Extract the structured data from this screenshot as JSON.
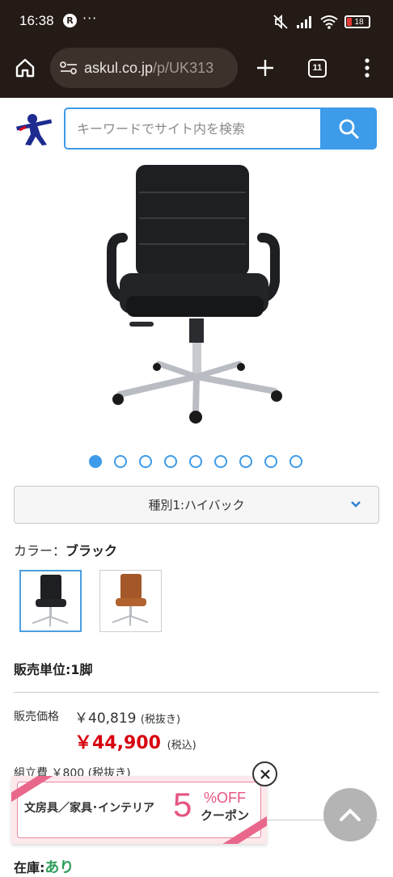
{
  "status_bar": {
    "time": "16:38",
    "notif_badge": "R",
    "more": "···",
    "battery": "18"
  },
  "browser": {
    "url_host": "askul.co.jp",
    "url_path": "/p/UK313",
    "tab_count": "11"
  },
  "header": {
    "search_placeholder": "キーワードでサイト内を検索"
  },
  "gallery": {
    "dot_count": 9,
    "active_index": 0
  },
  "variant": {
    "label": "種別1:ハイバック"
  },
  "color": {
    "label": "カラー：",
    "value": "ブラック",
    "options": [
      "ブラック",
      "ブラウン"
    ]
  },
  "unit": "販売単位:1脚",
  "price": {
    "label": "販売価格",
    "ex_tax": "￥40,819",
    "ex_tax_note": "(税抜き)",
    "in_tax": "￥44,900",
    "in_tax_note": "(税込)"
  },
  "assembly_partial": "組立費 ￥800 (税抜き)",
  "coupon": {
    "text": "文房具／家具･インテリア",
    "number": "5",
    "percent": "%OFF",
    "coupon_word": "クーポン"
  },
  "stock": {
    "label": "在庫:",
    "value": "あり"
  },
  "colors": {
    "accent": "#3d9be9",
    "price_red": "#d7000f",
    "coupon_pink": "#e6557f",
    "stock_green": "#2f9e5b",
    "browser_bg": "#241b16"
  }
}
